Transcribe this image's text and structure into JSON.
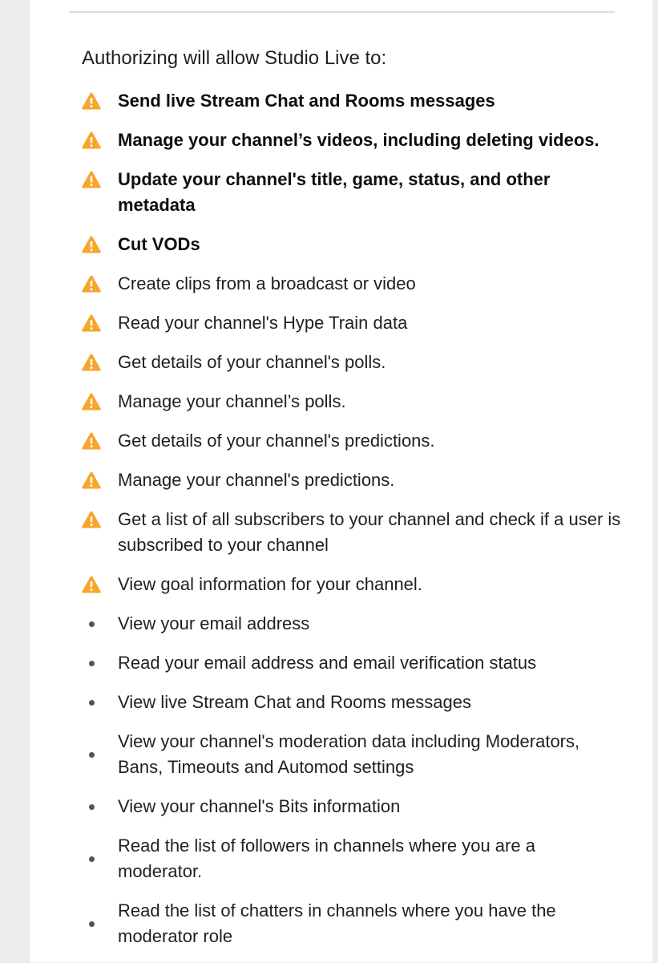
{
  "colors": {
    "warning": "#f8a52c",
    "background": "#ececee",
    "card": "#ffffff",
    "text": "#1f1f23"
  },
  "header": {
    "title": "Authorizing will allow Studio Live to:"
  },
  "permissions": [
    {
      "icon": "warning-icon",
      "bold": true,
      "text": "Send live Stream Chat and Rooms messages"
    },
    {
      "icon": "warning-icon",
      "bold": true,
      "text": "Manage your channel’s videos, including deleting videos."
    },
    {
      "icon": "warning-icon",
      "bold": true,
      "text": "Update your channel's title, game, status, and other metadata"
    },
    {
      "icon": "warning-icon",
      "bold": true,
      "text": "Cut VODs"
    },
    {
      "icon": "warning-icon",
      "bold": false,
      "text": "Create clips from a broadcast or video"
    },
    {
      "icon": "warning-icon",
      "bold": false,
      "text": "Read your channel's Hype Train data"
    },
    {
      "icon": "warning-icon",
      "bold": false,
      "text": "Get details of your channel's polls."
    },
    {
      "icon": "warning-icon",
      "bold": false,
      "text": "Manage your channel’s polls."
    },
    {
      "icon": "warning-icon",
      "bold": false,
      "text": "Get details of your channel's predictions."
    },
    {
      "icon": "warning-icon",
      "bold": false,
      "text": "Manage your channel's predictions."
    },
    {
      "icon": "warning-icon",
      "bold": false,
      "text": "Get a list of all subscribers to your channel and check if a user is subscribed to your channel"
    },
    {
      "icon": "warning-icon",
      "bold": false,
      "text": "View goal information for your channel."
    },
    {
      "icon": "bullet",
      "bold": false,
      "text": "View your email address"
    },
    {
      "icon": "bullet",
      "bold": false,
      "text": "Read your email address and email verification status"
    },
    {
      "icon": "bullet",
      "bold": false,
      "text": "View live Stream Chat and Rooms messages"
    },
    {
      "icon": "bullet",
      "bold": false,
      "text": "View your channel's moderation data including Moderators, Bans, Timeouts and Automod settings"
    },
    {
      "icon": "bullet",
      "bold": false,
      "text": "View your channel's Bits information"
    },
    {
      "icon": "bullet",
      "bold": false,
      "text": "Read the list of followers in channels where you are a moderator."
    },
    {
      "icon": "bullet",
      "bold": false,
      "text": "Read the list of chatters in channels where you have the moderator role"
    }
  ]
}
